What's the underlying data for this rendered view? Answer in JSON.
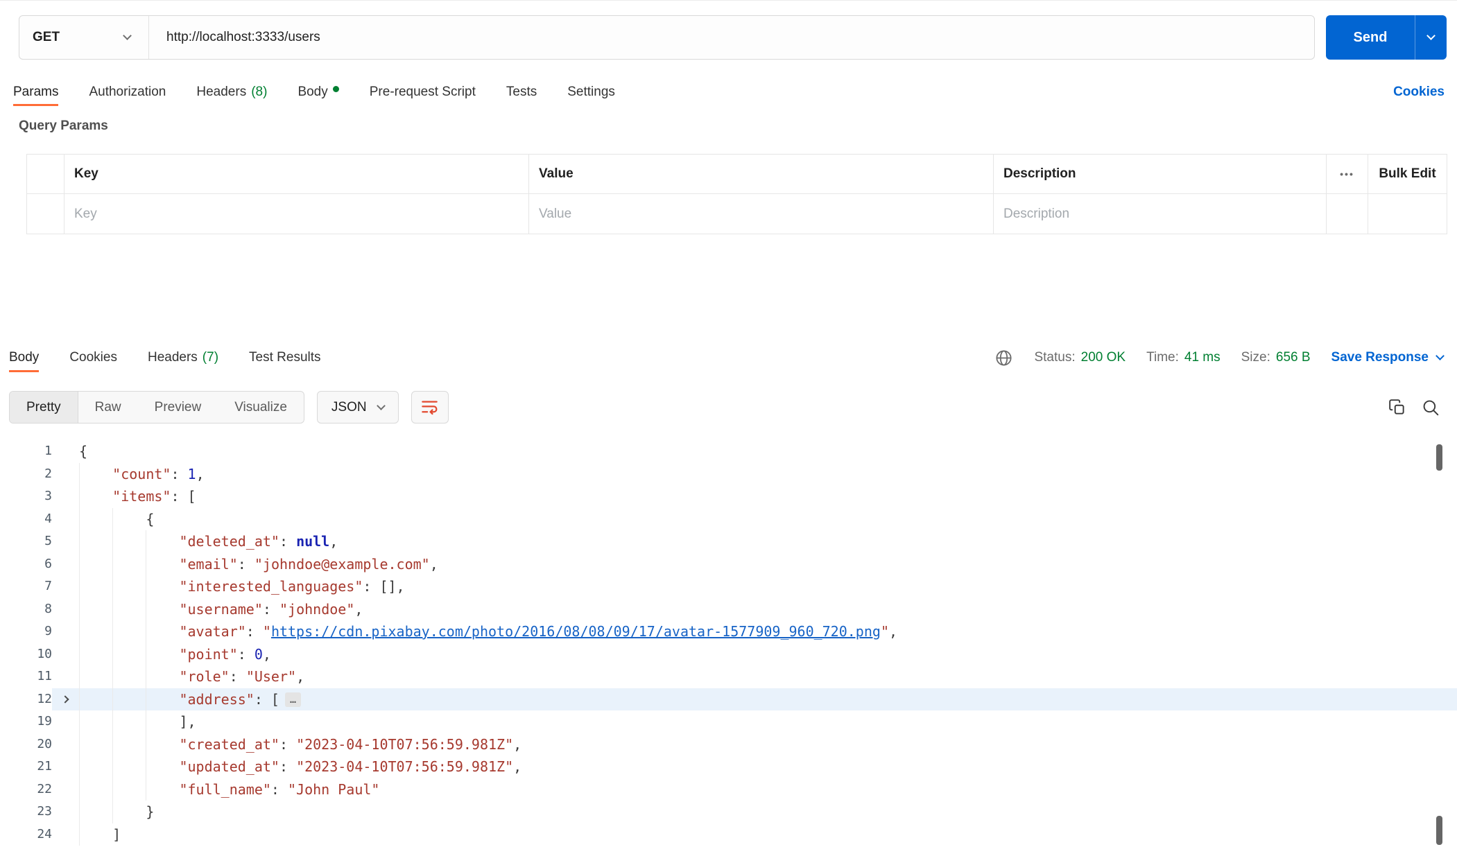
{
  "request": {
    "method": "GET",
    "url": "http://localhost:3333/users",
    "send_label": "Send",
    "tabs": [
      {
        "label": "Params",
        "active": true
      },
      {
        "label": "Authorization"
      },
      {
        "label": "Headers",
        "badge": "(8)"
      },
      {
        "label": "Body",
        "dot": true
      },
      {
        "label": "Pre-request Script"
      },
      {
        "label": "Tests"
      },
      {
        "label": "Settings"
      }
    ],
    "cookies_link": "Cookies",
    "query_params": {
      "title": "Query Params",
      "columns": [
        "Key",
        "Value",
        "Description"
      ],
      "more_icon": "•••",
      "bulk_edit_label": "Bulk Edit",
      "placeholders": [
        "Key",
        "Value",
        "Description"
      ]
    }
  },
  "response": {
    "tabs": [
      {
        "label": "Body",
        "active": true
      },
      {
        "label": "Cookies"
      },
      {
        "label": "Headers",
        "badge": "(7)"
      },
      {
        "label": "Test Results"
      }
    ],
    "meta": {
      "status_label": "Status:",
      "status_value": "200 OK",
      "time_label": "Time:",
      "time_value": "41 ms",
      "size_label": "Size:",
      "size_value": "656 B",
      "save_label": "Save Response"
    },
    "view_modes": [
      "Pretty",
      "Raw",
      "Preview",
      "Visualize"
    ],
    "active_view": "Pretty",
    "format_label": "JSON",
    "code": {
      "lines": [
        {
          "num": 1,
          "indent": 0,
          "tokens": [
            [
              "p",
              "{"
            ]
          ]
        },
        {
          "num": 2,
          "indent": 1,
          "tokens": [
            [
              "k",
              "\"count\""
            ],
            [
              "p",
              ": "
            ],
            [
              "n",
              "1"
            ],
            [
              "p",
              ","
            ]
          ]
        },
        {
          "num": 3,
          "indent": 1,
          "tokens": [
            [
              "k",
              "\"items\""
            ],
            [
              "p",
              ": ["
            ]
          ]
        },
        {
          "num": 4,
          "indent": 2,
          "tokens": [
            [
              "p",
              "{"
            ]
          ]
        },
        {
          "num": 5,
          "indent": 3,
          "tokens": [
            [
              "k",
              "\"deleted_at\""
            ],
            [
              "p",
              ": "
            ],
            [
              "u",
              "null"
            ],
            [
              "p",
              ","
            ]
          ]
        },
        {
          "num": 6,
          "indent": 3,
          "tokens": [
            [
              "k",
              "\"email\""
            ],
            [
              "p",
              ": "
            ],
            [
              "s",
              "\"johndoe@example.com\""
            ],
            [
              "p",
              ","
            ]
          ]
        },
        {
          "num": 7,
          "indent": 3,
          "tokens": [
            [
              "k",
              "\"interested_languages\""
            ],
            [
              "p",
              ": [],"
            ]
          ]
        },
        {
          "num": 8,
          "indent": 3,
          "tokens": [
            [
              "k",
              "\"username\""
            ],
            [
              "p",
              ": "
            ],
            [
              "s",
              "\"johndoe\""
            ],
            [
              "p",
              ","
            ]
          ]
        },
        {
          "num": 9,
          "indent": 3,
          "tokens": [
            [
              "k",
              "\"avatar\""
            ],
            [
              "p",
              ": "
            ],
            [
              "s",
              "\""
            ],
            [
              "l",
              "https://cdn.pixabay.com/photo/2016/08/08/09/17/avatar-1577909_960_720.png"
            ],
            [
              "s",
              "\""
            ],
            [
              "p",
              ","
            ]
          ]
        },
        {
          "num": 10,
          "indent": 3,
          "tokens": [
            [
              "k",
              "\"point\""
            ],
            [
              "p",
              ": "
            ],
            [
              "n",
              "0"
            ],
            [
              "p",
              ","
            ]
          ]
        },
        {
          "num": 11,
          "indent": 3,
          "tokens": [
            [
              "k",
              "\"role\""
            ],
            [
              "p",
              ": "
            ],
            [
              "s",
              "\"User\""
            ],
            [
              "p",
              ","
            ]
          ]
        },
        {
          "num": 12,
          "indent": 3,
          "hl": true,
          "arrow": true,
          "tokens": [
            [
              "k",
              "\"address\""
            ],
            [
              "p",
              ": ["
            ],
            [
              "e",
              "…"
            ]
          ]
        },
        {
          "num": 19,
          "indent": 3,
          "tokens": [
            [
              "p",
              "],"
            ]
          ]
        },
        {
          "num": 20,
          "indent": 3,
          "tokens": [
            [
              "k",
              "\"created_at\""
            ],
            [
              "p",
              ": "
            ],
            [
              "s",
              "\"2023-04-10T07:56:59.981Z\""
            ],
            [
              "p",
              ","
            ]
          ]
        },
        {
          "num": 21,
          "indent": 3,
          "tokens": [
            [
              "k",
              "\"updated_at\""
            ],
            [
              "p",
              ": "
            ],
            [
              "s",
              "\"2023-04-10T07:56:59.981Z\""
            ],
            [
              "p",
              ","
            ]
          ]
        },
        {
          "num": 22,
          "indent": 3,
          "tokens": [
            [
              "k",
              "\"full_name\""
            ],
            [
              "p",
              ": "
            ],
            [
              "s",
              "\"John Paul\""
            ]
          ]
        },
        {
          "num": 23,
          "indent": 2,
          "tokens": [
            [
              "p",
              "}"
            ]
          ]
        },
        {
          "num": 24,
          "indent": 1,
          "tokens": [
            [
              "p",
              "]"
            ]
          ]
        }
      ]
    }
  },
  "colors": {
    "accent_orange": "#FF6C37",
    "primary_blue": "#0265D2",
    "success_green": "#007F31"
  }
}
